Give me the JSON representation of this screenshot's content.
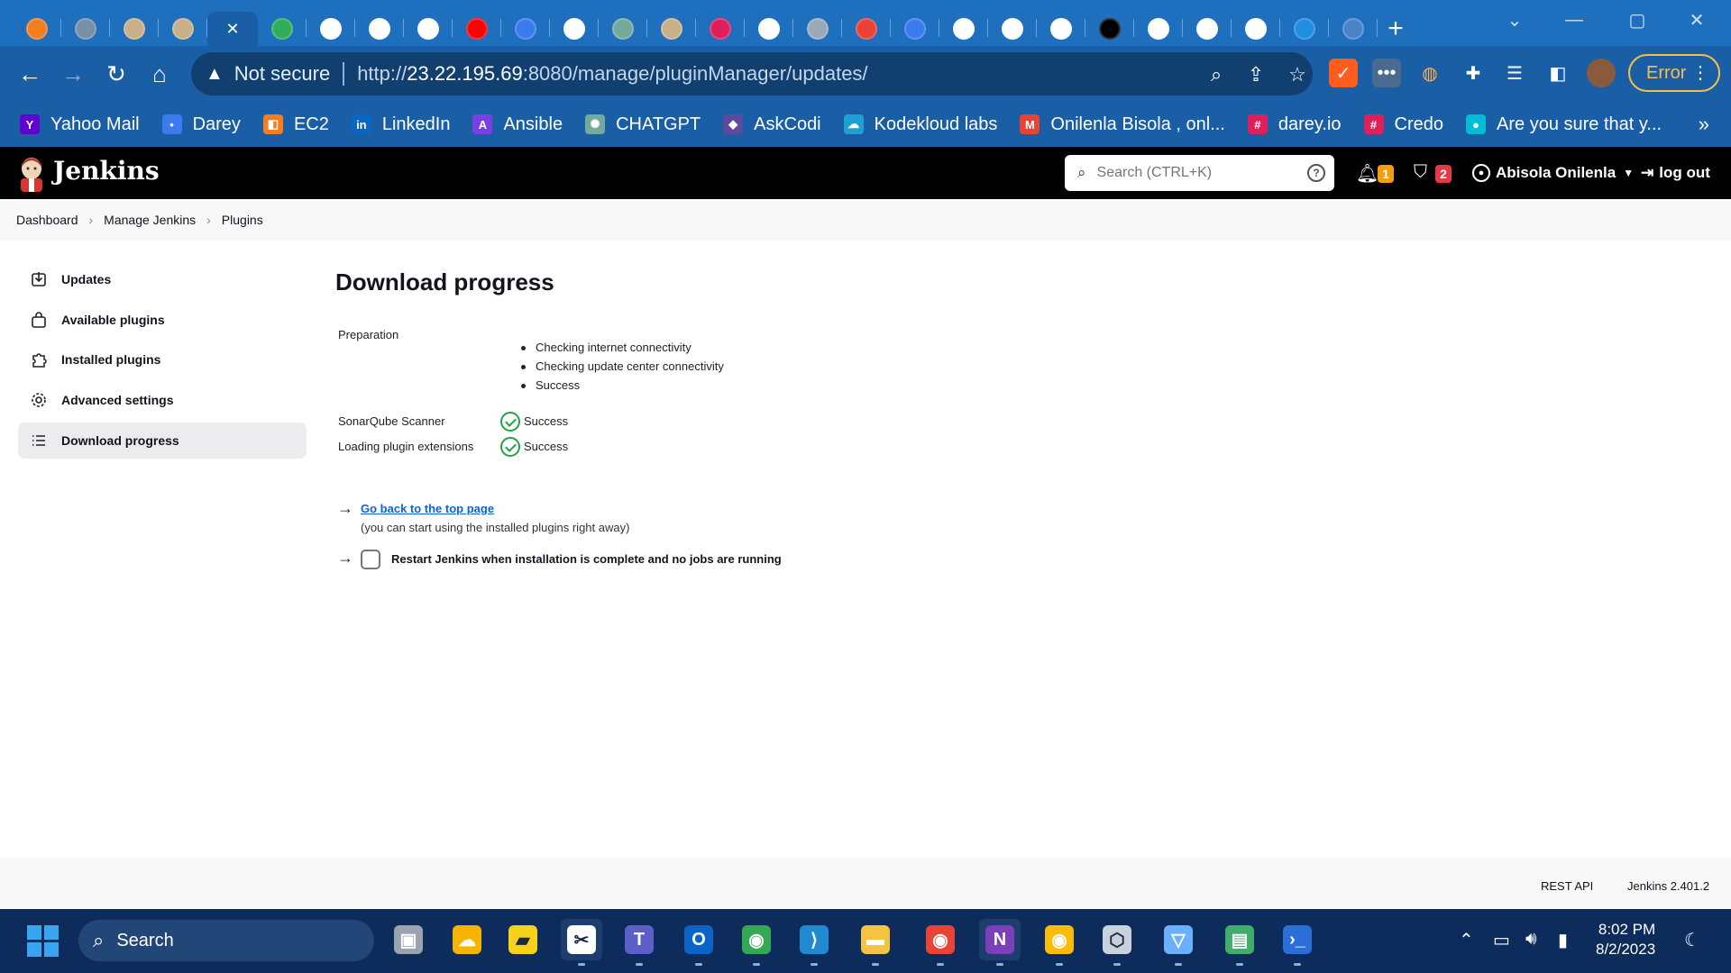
{
  "browser": {
    "tabs": [
      {
        "icon": "orange-square-icon",
        "color": "#f47e20"
      },
      {
        "icon": "grey-wave-icon",
        "color": "#7a8fa8"
      },
      {
        "icon": "jenkins-icon",
        "color": "#c9b08a"
      },
      {
        "icon": "jenkins-icon",
        "color": "#c9b08a"
      },
      {
        "icon": "active-tab",
        "color": "#ffffff",
        "active": true
      },
      {
        "icon": "green-frog-icon",
        "color": "#2fae5a"
      },
      {
        "icon": "github-icon",
        "color": "#ffffff"
      },
      {
        "icon": "github-icon",
        "color": "#ffffff"
      },
      {
        "icon": "github-icon",
        "color": "#ffffff"
      },
      {
        "icon": "youtube-icon",
        "color": "#ff0000"
      },
      {
        "icon": "darey-icon",
        "color": "#3b7bf0"
      },
      {
        "icon": "github-icon",
        "color": "#ffffff"
      },
      {
        "icon": "chatgpt-icon",
        "color": "#74aa9c"
      },
      {
        "icon": "jenkins-icon",
        "color": "#c9b08a"
      },
      {
        "icon": "slack-icon",
        "color": "#e01e5a"
      },
      {
        "icon": "github-icon",
        "color": "#ffffff"
      },
      {
        "icon": "globe-icon",
        "color": "#9aa8b8"
      },
      {
        "icon": "gmail-icon",
        "color": "#ea4335"
      },
      {
        "icon": "darey-icon",
        "color": "#3b7bf0"
      },
      {
        "icon": "github-icon",
        "color": "#ffffff"
      },
      {
        "icon": "google-icon",
        "color": "#ffffff"
      },
      {
        "icon": "github-icon",
        "color": "#ffffff"
      },
      {
        "icon": "circle-icon",
        "color": "#000000"
      },
      {
        "icon": "wordpress-icon",
        "color": "#ffffff"
      },
      {
        "icon": "chrome-icon",
        "color": "#ffffff"
      },
      {
        "icon": "google-icon",
        "color": "#ffffff"
      },
      {
        "icon": "bracket-icon",
        "color": "#1f8de0"
      },
      {
        "icon": "ads-icon",
        "color": "#4a84c8"
      }
    ],
    "new_tab": "+",
    "address": {
      "security": "Not secure",
      "url_prefix": "http://",
      "url_host": "23.22.195.69",
      "url_rest": ":8080/manage/pluginManager/updates/"
    },
    "error_label": "Error",
    "bookmarks": [
      {
        "label": "Yahoo Mail",
        "color": "#6001d2",
        "glyph": "Y"
      },
      {
        "label": "Darey",
        "color": "#3b7bf0",
        "glyph": "•"
      },
      {
        "label": "EC2",
        "color": "#f47e20",
        "glyph": "◧"
      },
      {
        "label": "LinkedIn",
        "color": "#0a66c2",
        "glyph": "in"
      },
      {
        "label": "Ansible",
        "color": "#7b3fe4",
        "glyph": "A"
      },
      {
        "label": "CHATGPT",
        "color": "#74aa9c",
        "glyph": "✺"
      },
      {
        "label": "AskCodi",
        "color": "#5b4a9e",
        "glyph": "◆"
      },
      {
        "label": "Kodekloud labs",
        "color": "#1da1d4",
        "glyph": "☁"
      },
      {
        "label": "Onilenla Bisola , onl...",
        "color": "#ea4335",
        "glyph": "M"
      },
      {
        "label": "darey.io",
        "color": "#e01e5a",
        "glyph": "#"
      },
      {
        "label": "Credo",
        "color": "#e01e5a",
        "glyph": "#"
      },
      {
        "label": "Are you sure that y...",
        "color": "#00bcd4",
        "glyph": "●"
      }
    ],
    "bookmarks_more": "»"
  },
  "jenkins": {
    "title": "Jenkins",
    "search_placeholder": "Search (CTRL+K)",
    "notifications_count": "1",
    "security_count": "2",
    "user": "Abisola Onilenla",
    "logout": "log out",
    "breadcrumb": [
      "Dashboard",
      "Manage Jenkins",
      "Plugins"
    ],
    "sidebar": [
      {
        "label": "Updates",
        "icon": "download-icon"
      },
      {
        "label": "Available plugins",
        "icon": "shopping-bag-icon"
      },
      {
        "label": "Installed plugins",
        "icon": "puzzle-icon"
      },
      {
        "label": "Advanced settings",
        "icon": "gear-icon"
      },
      {
        "label": "Download progress",
        "icon": "list-icon",
        "active": true
      }
    ],
    "page_title": "Download progress",
    "preparation": {
      "label": "Preparation",
      "steps": [
        "Checking internet connectivity",
        "Checking update center connectivity",
        "Success"
      ]
    },
    "results": [
      {
        "name": "SonarQube Scanner",
        "status": "Success"
      },
      {
        "name": "Loading plugin extensions",
        "status": "Success"
      }
    ],
    "top_link": "Go back to the top page",
    "top_link_sub": "(you can start using the installed plugins right away)",
    "restart_label": "Restart Jenkins when installation is complete and no jobs are running",
    "footer": {
      "rest_api": "REST API",
      "version": "Jenkins 2.401.2"
    }
  },
  "taskbar": {
    "search_label": "Search",
    "apps": [
      {
        "name": "task-view",
        "color": "#9aa4b1",
        "glyph": "▣"
      },
      {
        "name": "weather",
        "color": "#f5b400",
        "glyph": "☁"
      },
      {
        "name": "sticky-notes",
        "color": "#f7d21a",
        "glyph": "▰"
      },
      {
        "name": "snipping-tool",
        "color": "#ffffff",
        "glyph": "✂"
      },
      {
        "name": "teams",
        "color": "#5b5fc7",
        "glyph": "T"
      },
      {
        "name": "outlook",
        "color": "#0a64c8",
        "glyph": "O"
      },
      {
        "name": "chrome",
        "color": "#34a853",
        "glyph": "◉"
      },
      {
        "name": "vscode",
        "color": "#1f8ad2",
        "glyph": "⟩"
      },
      {
        "name": "file-explorer",
        "color": "#f5c342",
        "glyph": "▬"
      },
      {
        "name": "chrome",
        "color": "#ea4335",
        "glyph": "◉"
      },
      {
        "name": "onenote",
        "color": "#7b3fb8",
        "glyph": "N"
      },
      {
        "name": "chrome",
        "color": "#fbbc05",
        "glyph": "◉"
      },
      {
        "name": "virtualbox",
        "color": "#c7d2dd",
        "glyph": "⬡"
      },
      {
        "name": "vpn",
        "color": "#6ab0ff",
        "glyph": "▽"
      },
      {
        "name": "image-viewer",
        "color": "#3fae6a",
        "glyph": "▤"
      },
      {
        "name": "powershell",
        "color": "#2a6ed8",
        "glyph": "›_"
      }
    ],
    "time": "8:02 PM",
    "date": "8/2/2023"
  }
}
